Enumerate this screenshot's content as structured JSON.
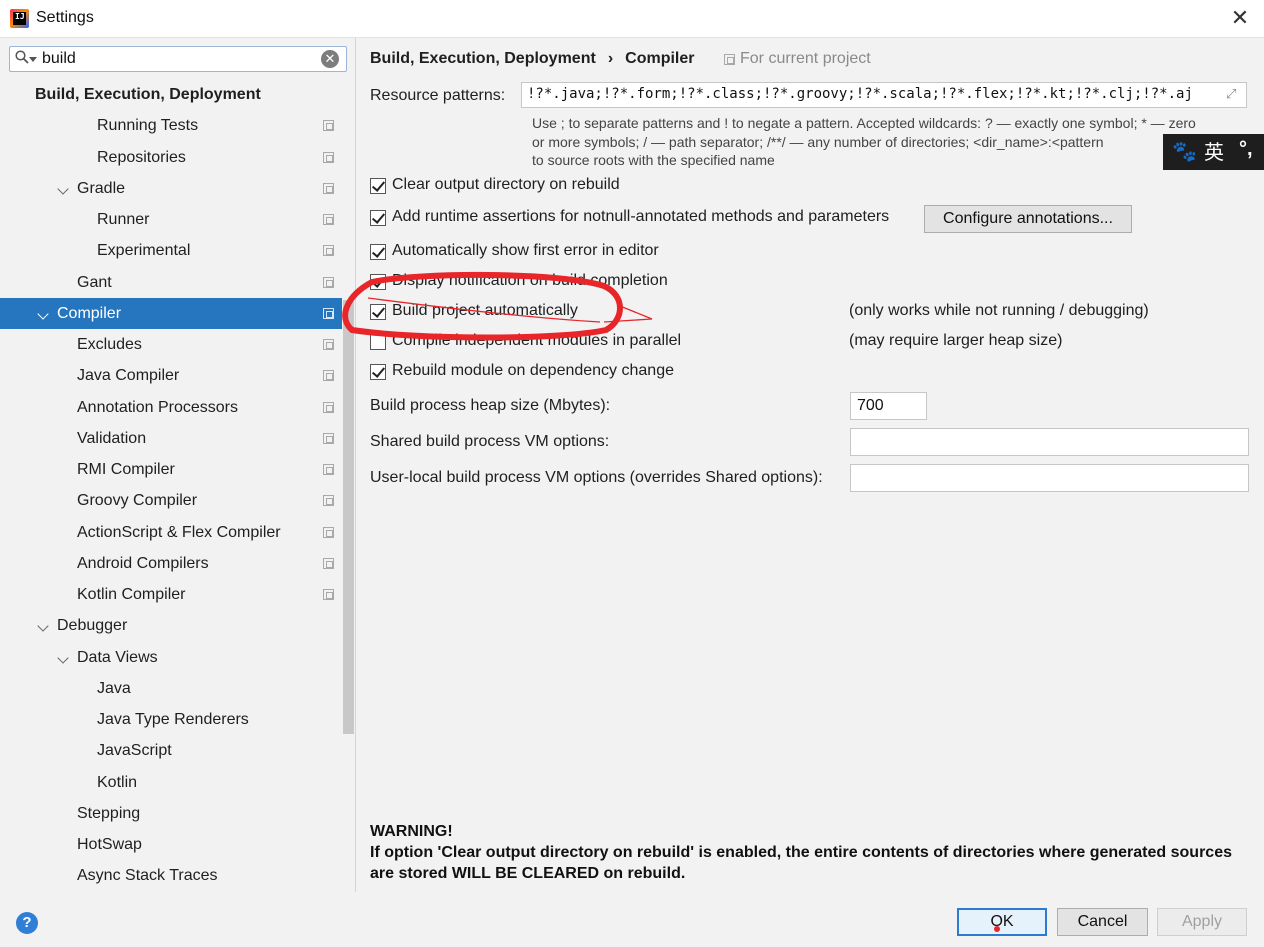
{
  "window": {
    "title": "Settings",
    "icon_text": "IJ"
  },
  "search": {
    "value": "build"
  },
  "tree": {
    "items": [
      {
        "label": "Build, Execution, Deployment",
        "level": 0,
        "bold": true,
        "expanded": null,
        "project_icon": false
      },
      {
        "label": "Running Tests",
        "level": 3,
        "expanded": null,
        "project_icon": true
      },
      {
        "label": "Repositories",
        "level": 3,
        "expanded": null,
        "project_icon": true
      },
      {
        "label": "Gradle",
        "level": 2,
        "expanded": true,
        "project_icon": true
      },
      {
        "label": "Runner",
        "level": 3,
        "expanded": null,
        "project_icon": true
      },
      {
        "label": "Experimental",
        "level": 3,
        "expanded": null,
        "project_icon": true
      },
      {
        "label": "Gant",
        "level": 2,
        "expanded": null,
        "project_icon": true
      },
      {
        "label": "Compiler",
        "level": 1,
        "expanded": true,
        "selected": true,
        "project_icon": true
      },
      {
        "label": "Excludes",
        "level": 2,
        "expanded": null,
        "project_icon": true
      },
      {
        "label": "Java Compiler",
        "level": 2,
        "expanded": null,
        "project_icon": true
      },
      {
        "label": "Annotation Processors",
        "level": 2,
        "expanded": null,
        "project_icon": true
      },
      {
        "label": "Validation",
        "level": 2,
        "expanded": null,
        "project_icon": true
      },
      {
        "label": "RMI Compiler",
        "level": 2,
        "expanded": null,
        "project_icon": true
      },
      {
        "label": "Groovy Compiler",
        "level": 2,
        "expanded": null,
        "project_icon": true
      },
      {
        "label": "ActionScript & Flex Compiler",
        "level": 2,
        "expanded": null,
        "project_icon": true
      },
      {
        "label": "Android Compilers",
        "level": 2,
        "expanded": null,
        "project_icon": true
      },
      {
        "label": "Kotlin Compiler",
        "level": 2,
        "expanded": null,
        "project_icon": true
      },
      {
        "label": "Debugger",
        "level": 1,
        "expanded": true,
        "project_icon": false
      },
      {
        "label": "Data Views",
        "level": 2,
        "expanded": true,
        "project_icon": false
      },
      {
        "label": "Java",
        "level": 3,
        "expanded": null,
        "project_icon": false
      },
      {
        "label": "Java Type Renderers",
        "level": 3,
        "expanded": null,
        "project_icon": false
      },
      {
        "label": "JavaScript",
        "level": 3,
        "expanded": null,
        "project_icon": false
      },
      {
        "label": "Kotlin",
        "level": 3,
        "expanded": null,
        "project_icon": false
      },
      {
        "label": "Stepping",
        "level": 2,
        "expanded": null,
        "project_icon": false
      },
      {
        "label": "HotSwap",
        "level": 2,
        "expanded": null,
        "project_icon": false
      },
      {
        "label": "Async Stack Traces",
        "level": 2,
        "expanded": null,
        "project_icon": false
      }
    ]
  },
  "main": {
    "breadcrumb": [
      "Build, Execution, Deployment",
      "Compiler"
    ],
    "breadcrumb_separator": "›",
    "for_current_project": "For current project",
    "resource_patterns": {
      "label": "Resource patterns:",
      "value": "!?*.java;!?*.form;!?*.class;!?*.groovy;!?*.scala;!?*.flex;!?*.kt;!?*.clj;!?*.aj"
    },
    "hint_lines": [
      "Use ; to separate patterns and ! to negate a pattern. Accepted wildcards: ? — exactly one symbol; * — zero",
      "or more symbols; / — path separator; /**/ — any number of directories; <dir_name>:<pattern",
      "to source roots with the specified name"
    ],
    "checkboxes": [
      {
        "label": "Clear output directory on rebuild",
        "checked": true,
        "note": ""
      },
      {
        "label": "Add runtime assertions for notnull-annotated methods and parameters",
        "checked": true,
        "note": ""
      },
      {
        "label": "Automatically show first error in editor",
        "checked": true,
        "note": ""
      },
      {
        "label": "Display notification on build completion",
        "checked": true,
        "note": ""
      },
      {
        "label": "Build project automatically",
        "checked": true,
        "note": "(only works while not running / debugging)"
      },
      {
        "label": "Compile independent modules in parallel",
        "checked": false,
        "note": "(may require larger heap size)"
      },
      {
        "label": "Rebuild module on dependency change",
        "checked": true,
        "note": ""
      }
    ],
    "configure_annotations_label": "Configure annotations...",
    "heap_size": {
      "label": "Build process heap size (Mbytes):",
      "value": "700"
    },
    "shared_vm": {
      "label": "Shared build process VM options:",
      "value": ""
    },
    "user_vm": {
      "label": "User-local build process VM options (overrides Shared options):",
      "value": ""
    },
    "warning": {
      "title": "WARNING!",
      "lines": [
        "If option 'Clear output directory on rebuild' is enabled, the entire contents of directories where generated sources",
        "are stored WILL BE CLEARED on rebuild."
      ]
    }
  },
  "ime": {
    "paw": "🐾",
    "mode": "英",
    "punct": "°,"
  },
  "footer": {
    "help": "?",
    "ok": "OK",
    "cancel": "Cancel",
    "apply": "Apply"
  },
  "colors": {
    "accent": "#2675bf",
    "annotation": "#e8262a"
  }
}
